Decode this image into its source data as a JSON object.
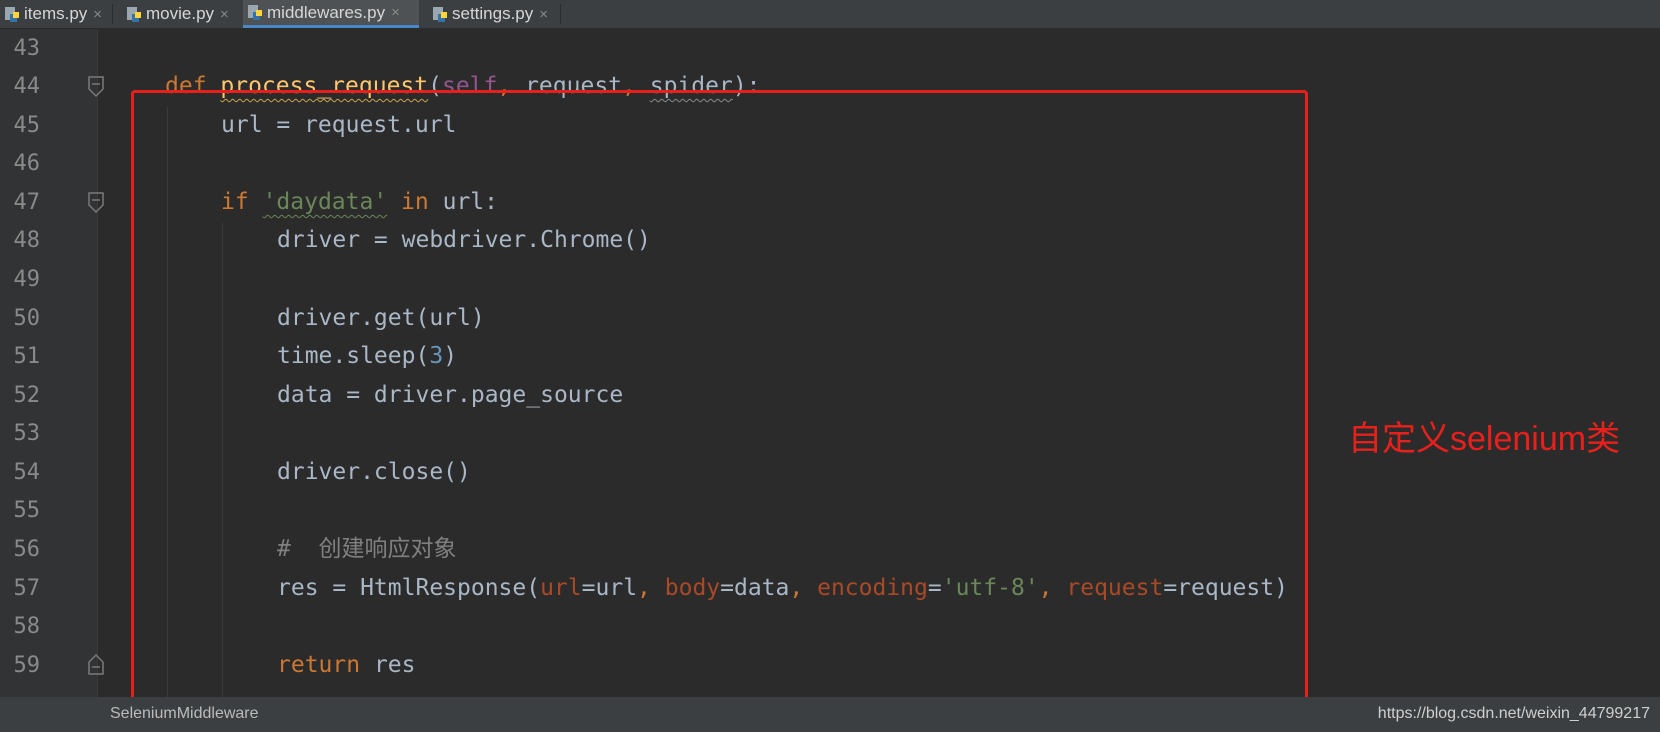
{
  "tabs": [
    {
      "label": "items.py",
      "active": false,
      "close": "×"
    },
    {
      "label": "movie.py",
      "active": false,
      "close": "×"
    },
    {
      "label": "middlewares.py",
      "active": true,
      "close": "×"
    },
    {
      "label": "settings.py",
      "active": false,
      "close": "×"
    }
  ],
  "line_numbers": [
    "43",
    "44",
    "45",
    "46",
    "47",
    "48",
    "49",
    "50",
    "51",
    "52",
    "53",
    "54",
    "55",
    "56",
    "57",
    "58",
    "59"
  ],
  "code": {
    "l44": {
      "def": "def",
      "name": "process_request",
      "open": "(",
      "self": "self",
      "c1": ", ",
      "request": "request",
      "c2": ", ",
      "spider": "spider",
      "close": "):"
    },
    "l45": "url = request.url",
    "l47": {
      "if": "if",
      "str": "'daydata'",
      "in": "in",
      "rest": " url:"
    },
    "l48": "driver = webdriver.Chrome()",
    "l50": "driver.get(url)",
    "l51": {
      "pre": "time.sleep(",
      "num": "3",
      "post": ")"
    },
    "l52": "data = driver.page_source",
    "l54": "driver.close()",
    "l56": "#  创建响应对象",
    "l57": {
      "pre": "res = HtmlResponse(",
      "p1": "url",
      "v1": "=url",
      "c1": ", ",
      "p2": "body",
      "v2": "=data",
      "c2": ", ",
      "p3": "encoding",
      "eq3": "=",
      "s3": "'utf-8'",
      "c3": ", ",
      "p4": "request",
      "v4": "=request)"
    },
    "l59": {
      "kw": "return",
      "rest": " res"
    }
  },
  "annotation": "自定义selenium类",
  "status": {
    "breadcrumb": "SeleniumMiddleware",
    "watermark": "https://blog.csdn.net/weixin_44799217"
  },
  "colors": {
    "highlight_box": "#e8201b",
    "keyword": "#cc7832",
    "function": "#ffc66d",
    "string": "#6a8759",
    "number": "#6897bb",
    "param": "#aa4926",
    "self": "#94558d"
  }
}
